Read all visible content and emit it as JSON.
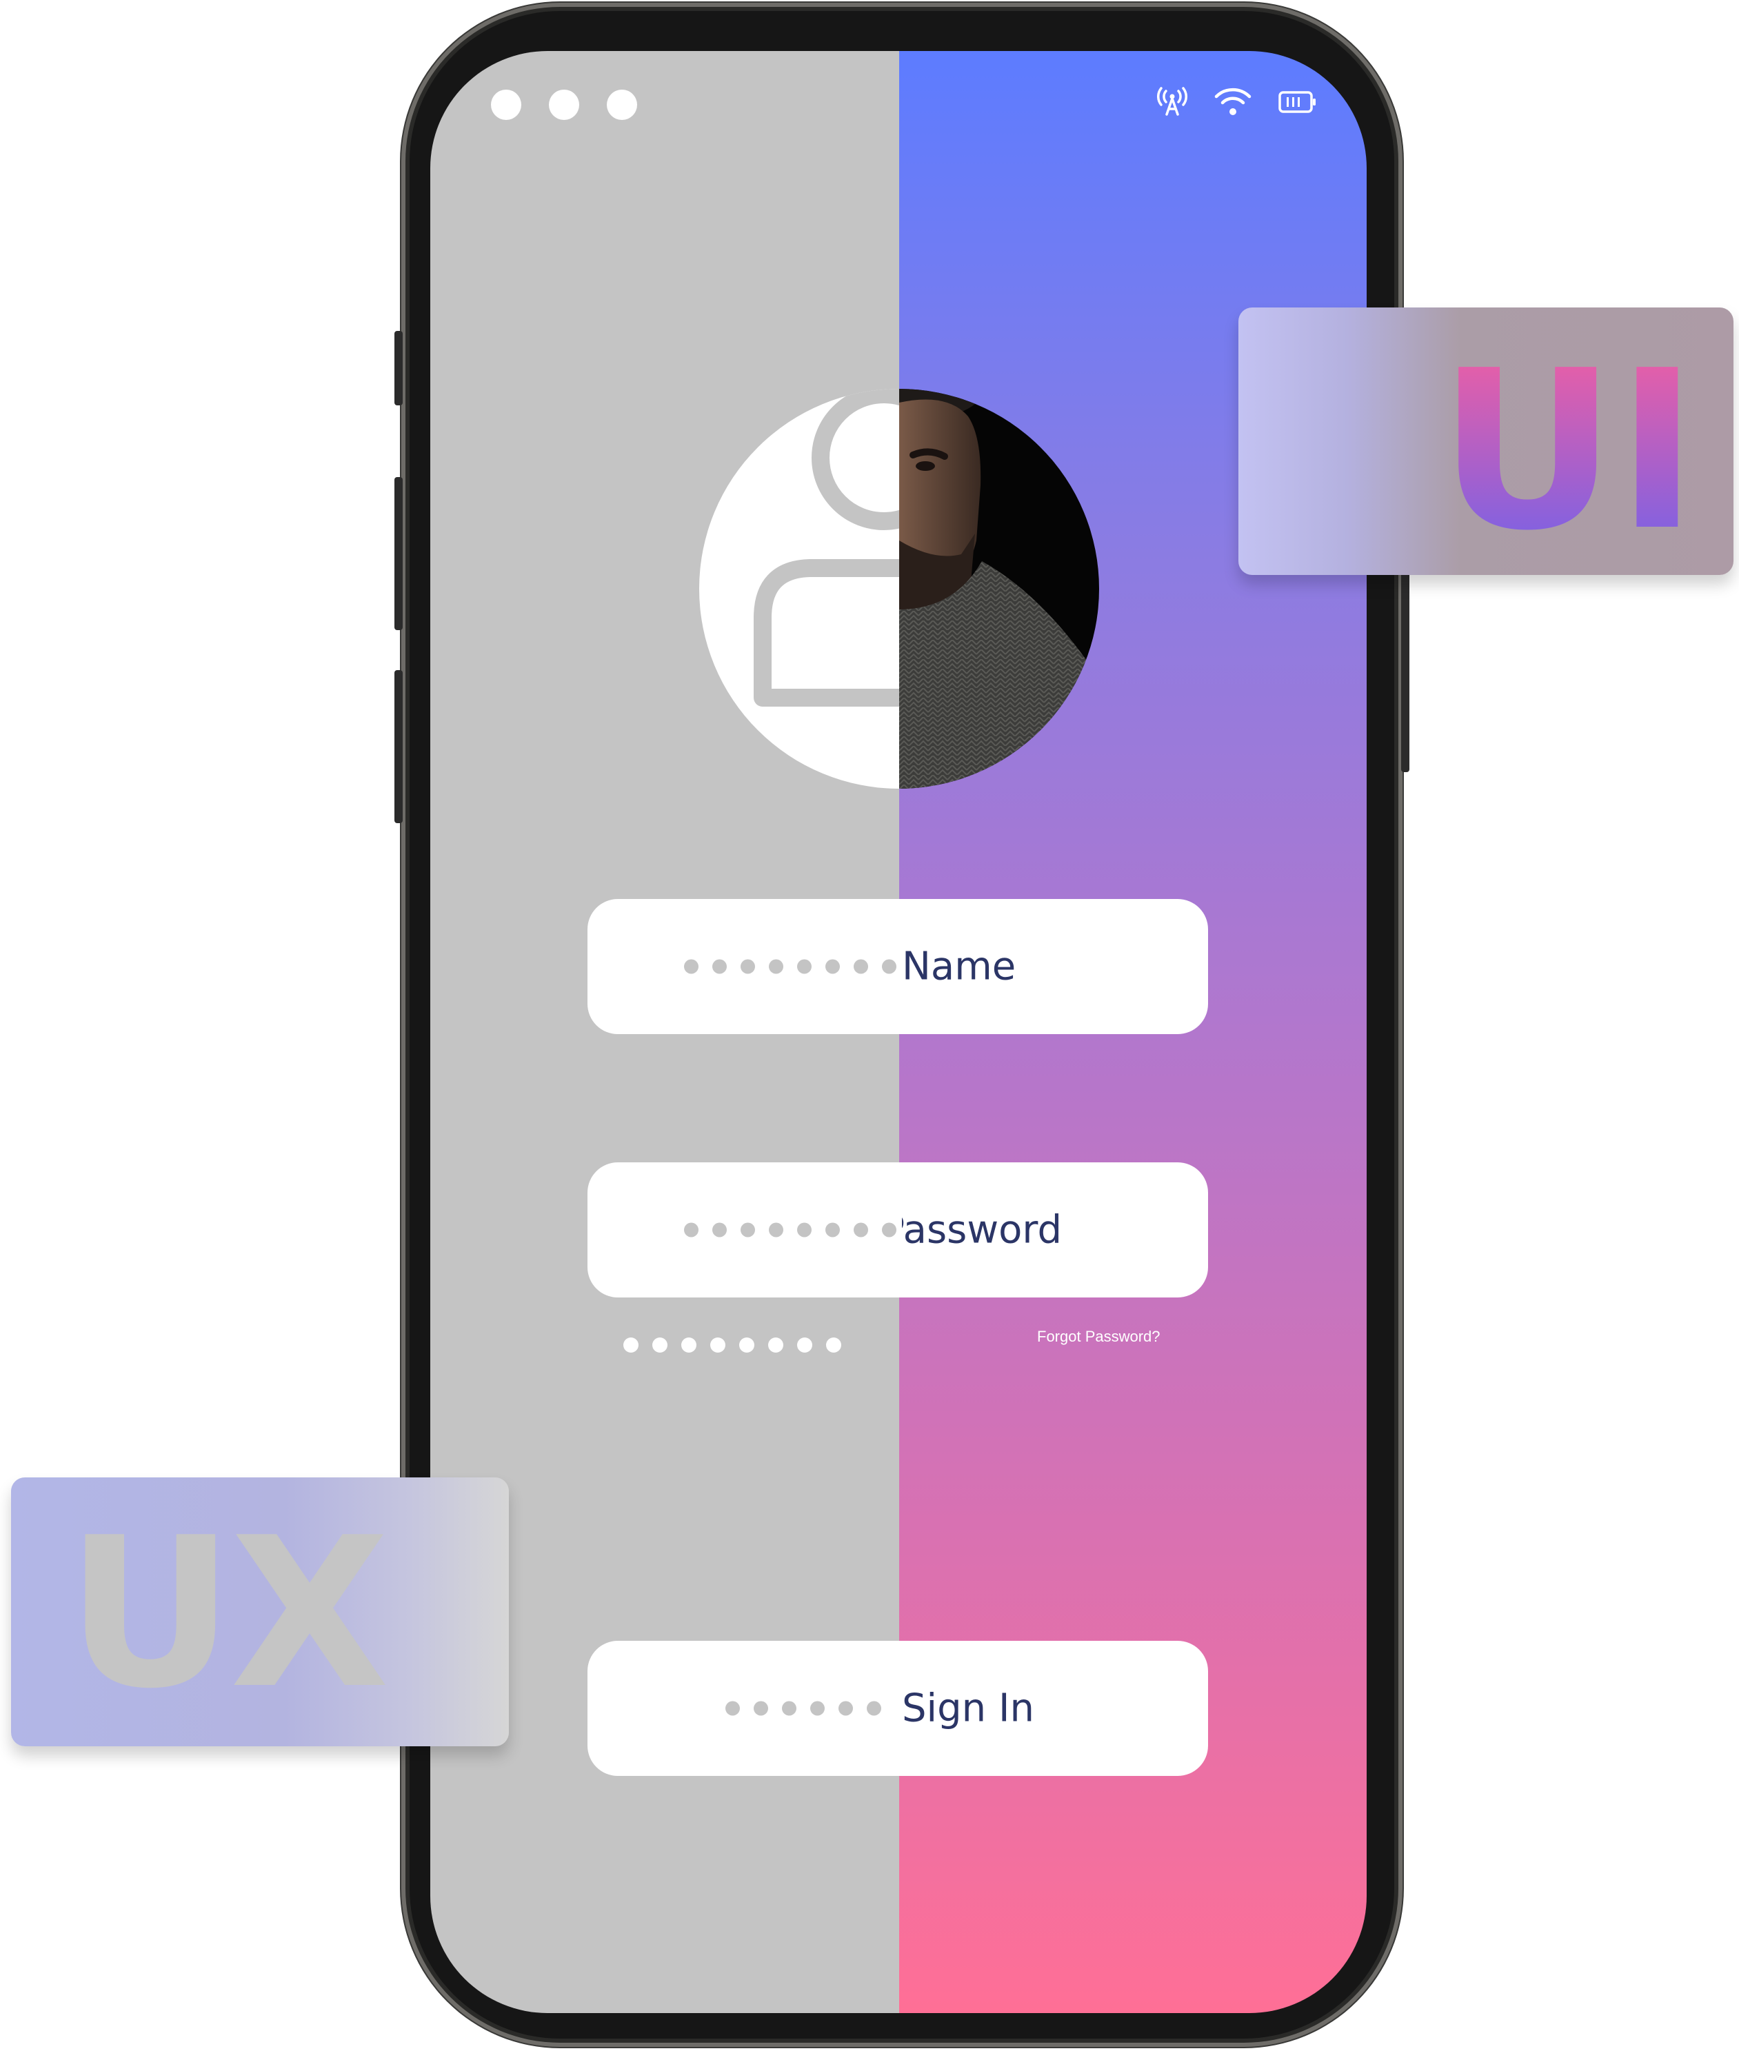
{
  "status_bar": {
    "icons": [
      "more-dots-icon",
      "cellular-tower-icon",
      "wifi-icon",
      "battery-icon"
    ]
  },
  "form": {
    "name_label": "Name",
    "password_label": "Password",
    "forgot_password": "Forgot Password?",
    "sign_in_label": "Sign In"
  },
  "cards": {
    "ui_label": "UI",
    "ux_label": "UX"
  },
  "colors": {
    "wireframe_gray": "#c4c4c4",
    "gradient_top": "#5d7cff",
    "gradient_bottom": "#ff6f96",
    "label_text": "#2b3566",
    "ui_text_top": "#fb5e9c",
    "ui_text_bottom": "#6a62ee",
    "ux_text": "#c5c5c5"
  }
}
